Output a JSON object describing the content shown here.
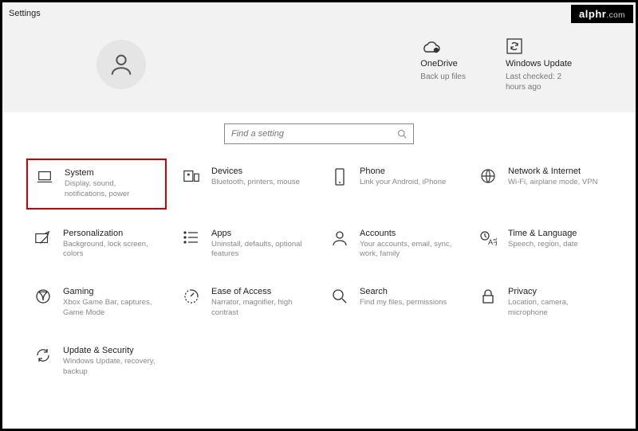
{
  "window": {
    "title": "Settings"
  },
  "logo": {
    "brand": "alphr",
    "suffix": ".com"
  },
  "header": {
    "onedrive": {
      "title": "OneDrive",
      "subtitle": "Back up files"
    },
    "update": {
      "title": "Windows Update",
      "subtitle": "Last checked: 2 hours ago"
    }
  },
  "search": {
    "placeholder": "Find a setting"
  },
  "tiles": {
    "system": {
      "title": "System",
      "subtitle": "Display, sound, notifications, power"
    },
    "devices": {
      "title": "Devices",
      "subtitle": "Bluetooth, printers, mouse"
    },
    "phone": {
      "title": "Phone",
      "subtitle": "Link your Android, iPhone"
    },
    "network": {
      "title": "Network & Internet",
      "subtitle": "Wi-Fi, airplane mode, VPN"
    },
    "personalization": {
      "title": "Personalization",
      "subtitle": "Background, lock screen, colors"
    },
    "apps": {
      "title": "Apps",
      "subtitle": "Uninstall, defaults, optional features"
    },
    "accounts": {
      "title": "Accounts",
      "subtitle": "Your accounts, email, sync, work, family"
    },
    "time": {
      "title": "Time & Language",
      "subtitle": "Speech, region, date"
    },
    "gaming": {
      "title": "Gaming",
      "subtitle": "Xbox Game Bar, captures, Game Mode"
    },
    "ease": {
      "title": "Ease of Access",
      "subtitle": "Narrator, magnifier, high contrast"
    },
    "searchTile": {
      "title": "Search",
      "subtitle": "Find my files, permissions"
    },
    "privacy": {
      "title": "Privacy",
      "subtitle": "Location, camera, microphone"
    },
    "updateSecurity": {
      "title": "Update & Security",
      "subtitle": "Windows Update, recovery, backup"
    }
  }
}
